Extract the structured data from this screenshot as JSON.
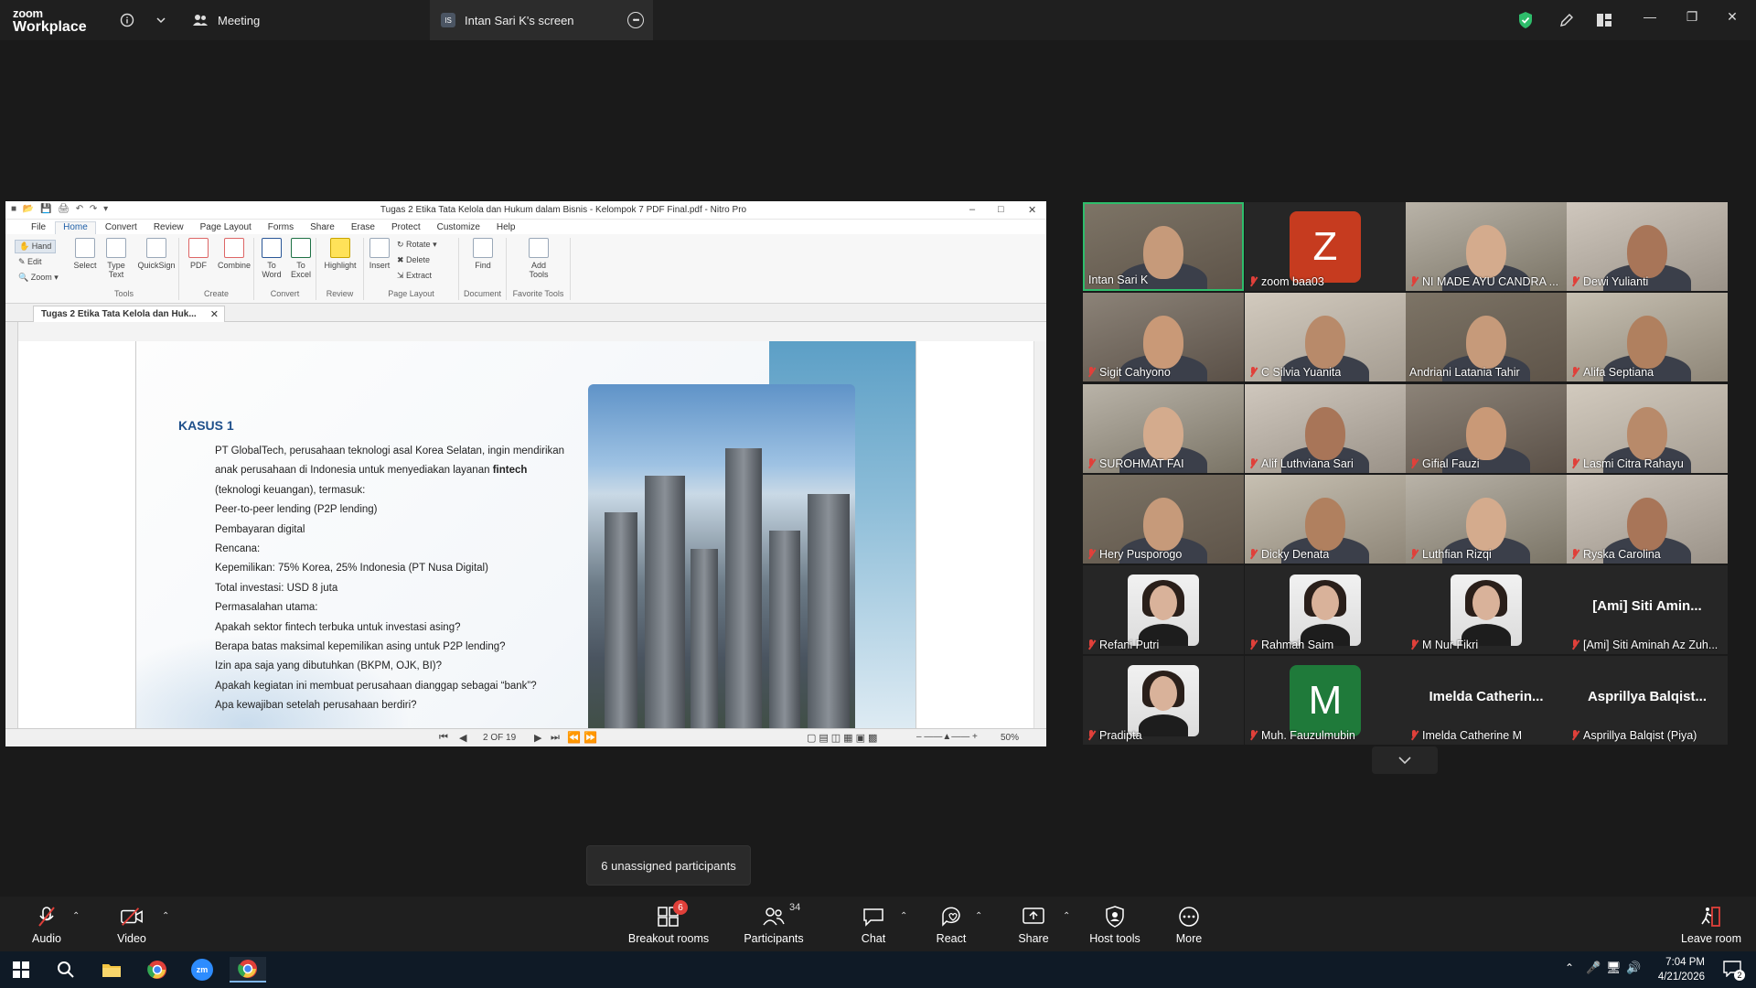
{
  "zoom_top": {
    "logo_line1": "zoom",
    "logo_line2": "Workplace",
    "meeting_tab": "Meeting",
    "share_badge": "IS",
    "screen_tab": "Intan Sari K's screen"
  },
  "nitro": {
    "title": "Tugas 2 Etika Tata Kelola dan Hukum dalam Bisnis - Kelompok 7 PDF Final.pdf - Nitro Pro",
    "menu": [
      "File",
      "Home",
      "Convert",
      "Review",
      "Page Layout",
      "Forms",
      "Share",
      "Erase",
      "Protect",
      "Customize",
      "Help"
    ],
    "ribbon": {
      "hand": "Hand",
      "edit": "Edit",
      "zoom": "Zoom",
      "select": "Select",
      "type_text": "Type\nText",
      "quicksign": "QuickSign",
      "tools_group": "Tools",
      "pdf": "PDF",
      "combine": "Combine",
      "create_group": "Create",
      "to_word": "To\nWord",
      "to_excel": "To\nExcel",
      "convert_group": "Convert",
      "highlight": "Highlight",
      "review_group": "Review",
      "insert": "Insert",
      "rotate": "Rotate",
      "delete": "Delete",
      "extract": "Extract",
      "page_layout_group": "Page Layout",
      "find": "Find",
      "document_group": "Document",
      "add_tools": "Add\nTools",
      "favorite_group": "Favorite Tools"
    },
    "doc_tab": "Tugas 2 Etika Tata Kelola dan Huk...",
    "document": {
      "heading": "KASUS 1",
      "lines": [
        "PT GlobalTech, perusahaan teknologi asal Korea Selatan, ingin mendirikan",
        "anak perusahaan di Indonesia untuk menyediakan layanan ",
        "(teknologi keuangan), termasuk:",
        "Peer-to-peer lending (P2P lending)",
        "Pembayaran digital",
        "Rencana:",
        "Kepemilikan: 75% Korea, 25% Indonesia (PT Nusa Digital)",
        "Total investasi: USD 8 juta",
        "Permasalahan utama:",
        "Apakah sektor fintech terbuka untuk investasi asing?",
        "Berapa batas maksimal kepemilikan asing untuk P2P lending?",
        "Izin apa saja yang dibutuhkan (BKPM, OJK, BI)?",
        "Apakah kegiatan ini membuat perusahaan dianggap sebagai “bank”?",
        "Apa kewajiban setelah perusahaan berdiri?"
      ],
      "bold_word": "fintech"
    },
    "status": {
      "page": "2 OF 19",
      "zoom": "50%"
    }
  },
  "participants_tiles": [
    {
      "name": "Intan Sari K",
      "muted": false,
      "type": "video",
      "active": true
    },
    {
      "name": "zoom baa03",
      "muted": true,
      "type": "letter",
      "letter": "Z",
      "color": "#c63b1f"
    },
    {
      "name": "NI MADE AYU CANDRA ...",
      "muted": true,
      "type": "video"
    },
    {
      "name": "Dewi Yulianti",
      "muted": true,
      "type": "video"
    },
    {
      "name": "Sigit Cahyono",
      "muted": true,
      "type": "video"
    },
    {
      "name": "C Silvia Yuanita",
      "muted": true,
      "type": "video"
    },
    {
      "name": "Andriani Latania Tahir",
      "muted": false,
      "type": "video"
    },
    {
      "name": "Alifa Septiana",
      "muted": true,
      "type": "video"
    },
    {
      "name": "SUROHMAT FAI",
      "muted": true,
      "type": "video"
    },
    {
      "name": "Alif Luthviana Sari",
      "muted": true,
      "type": "video"
    },
    {
      "name": "Gifial Fauzi",
      "muted": true,
      "type": "video"
    },
    {
      "name": "Lasmi Citra Rahayu",
      "muted": true,
      "type": "video"
    },
    {
      "name": "Hery Pusporogo",
      "muted": true,
      "type": "video"
    },
    {
      "name": "Dicky Denata",
      "muted": true,
      "type": "video"
    },
    {
      "name": "Luthfian Rizqi",
      "muted": true,
      "type": "video"
    },
    {
      "name": "Ryska Carolina",
      "muted": true,
      "type": "video"
    },
    {
      "name": "Refani Putri",
      "muted": true,
      "type": "photo"
    },
    {
      "name": "Rahmah Saim",
      "muted": true,
      "type": "photo"
    },
    {
      "name": "M Nur Fikri",
      "muted": true,
      "type": "photo"
    },
    {
      "name": "[Ami] Siti Aminah Az Zuh...",
      "muted": true,
      "type": "text",
      "big": "[Ami] Siti Amin..."
    },
    {
      "name": "Pradipta",
      "muted": true,
      "type": "photo"
    },
    {
      "name": "Muh. Fauzulmubin",
      "muted": true,
      "type": "letter",
      "letter": "M",
      "color": "#1f7a3a"
    },
    {
      "name": "Imelda Catherine M",
      "muted": true,
      "type": "text",
      "big": "Imelda Catherin..."
    },
    {
      "name": "Asprillya Balqist (Piya)",
      "muted": true,
      "type": "text",
      "big": "Asprillya Balqist..."
    }
  ],
  "tooltip": "6 unassigned participants",
  "toolbar": {
    "audio": "Audio",
    "video": "Video",
    "breakout": "Breakout rooms",
    "breakout_badge": "6",
    "participants": "Participants",
    "participants_count": "34",
    "chat": "Chat",
    "react": "React",
    "share": "Share",
    "host_tools": "Host tools",
    "more": "More",
    "leave": "Leave room"
  },
  "taskbar": {
    "time": "7:04 PM",
    "date": "4/21/2026",
    "notif": "2"
  },
  "colors": {
    "zoom_bg": "#1a1a1a",
    "active_speaker": "#2ebd6b",
    "mute_red": "#e0403a",
    "nitro_blue": "#1e4f8a"
  }
}
